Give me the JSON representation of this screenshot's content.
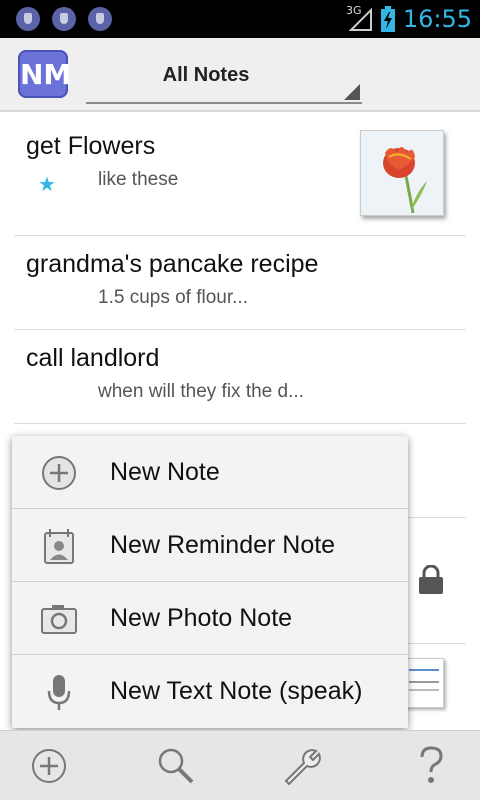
{
  "status_bar": {
    "network": "3G",
    "time": "16:55"
  },
  "header": {
    "logo_text": "NM",
    "filter_label": "All Notes"
  },
  "notes": [
    {
      "title": "get Flowers",
      "subtitle": "like these",
      "starred": true,
      "has_thumbnail": true
    },
    {
      "title": "grandma's pancake recipe",
      "subtitle": "1.5 cups of flour..."
    },
    {
      "title": "call landlord",
      "subtitle": "when will they fix the d..."
    }
  ],
  "menu": {
    "items": [
      {
        "label": "New Note",
        "icon": "add-circle-icon"
      },
      {
        "label": "New Reminder Note",
        "icon": "calendar-contact-icon"
      },
      {
        "label": "New Photo Note",
        "icon": "camera-icon"
      },
      {
        "label": "New Text Note (speak)",
        "icon": "microphone-icon"
      }
    ]
  },
  "bottom_bar": {
    "buttons": [
      "add-icon",
      "search-icon",
      "settings-wrench-icon",
      "help-icon"
    ]
  },
  "colors": {
    "accent": "#33b5e5",
    "logo": "#6b73d8"
  }
}
